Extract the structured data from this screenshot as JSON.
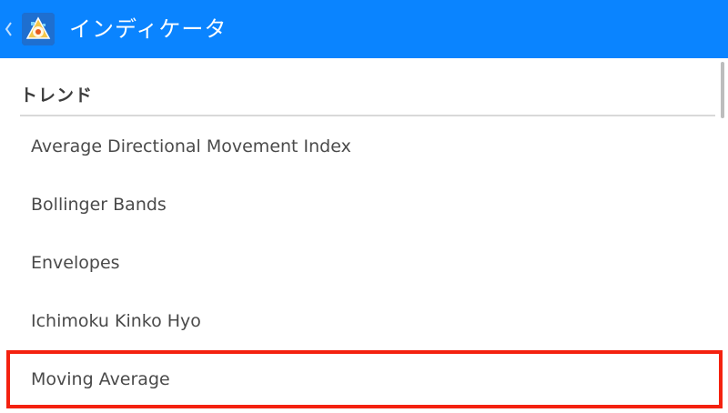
{
  "action_bar": {
    "title": "インディケータ",
    "background_color": "#0a84ff",
    "back_icon": "chevron-left-icon",
    "app_icon": "app-logo-icon"
  },
  "section": {
    "header": "トレンド",
    "items": [
      {
        "label": "Average Directional Movement Index"
      },
      {
        "label": "Bollinger Bands"
      },
      {
        "label": "Envelopes"
      },
      {
        "label": "Ichimoku Kinko Hyo"
      },
      {
        "label": "Moving Average"
      }
    ]
  },
  "highlight": {
    "color": "#f4210f",
    "target_item": "Moving Average"
  }
}
